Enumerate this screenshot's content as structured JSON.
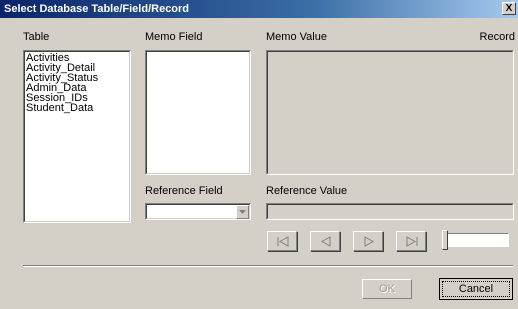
{
  "window": {
    "title": "Select Database Table/Field/Record",
    "close_glyph": "X"
  },
  "labels": {
    "table": "Table",
    "memo_field": "Memo Field",
    "memo_value": "Memo Value",
    "record": "Record",
    "reference_field": "Reference Field",
    "reference_value": "Reference Value"
  },
  "tables": [
    "Activities",
    "Activity_Detail",
    "Activity_Status",
    "Admin_Data",
    "Session_IDs",
    "Student_Data"
  ],
  "memo_fields": [],
  "memo_value": "",
  "reference_field": {
    "selected": ""
  },
  "reference_value": "",
  "navigation": {
    "icons": [
      "first-record-icon",
      "previous-record-icon",
      "next-record-icon",
      "last-record-icon"
    ],
    "record_slider_position": 0
  },
  "buttons": {
    "ok": "OK",
    "cancel": "Cancel"
  },
  "colors": {
    "dialog_face": "#d4d0c8",
    "title_gradient_start": "#0a246a",
    "title_gradient_end": "#a6caf0",
    "disabled_text": "#a0a0a0"
  }
}
